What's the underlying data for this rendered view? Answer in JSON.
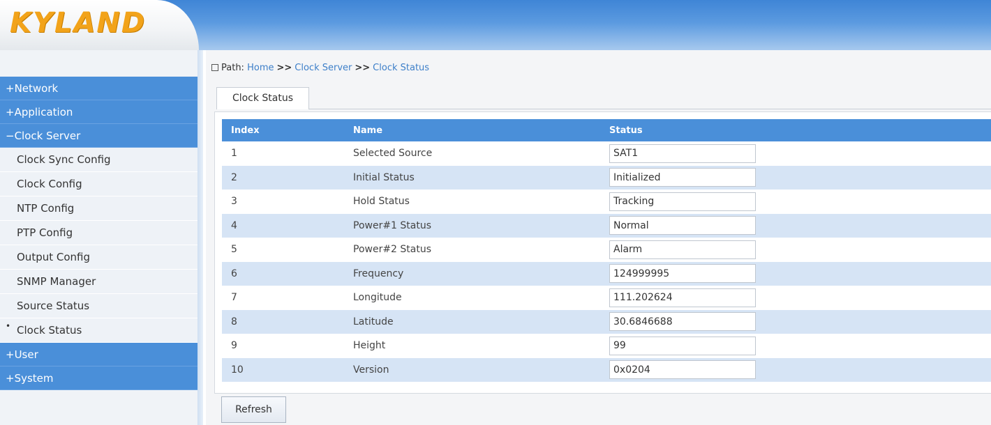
{
  "header": {
    "logo_text": "KYLAND"
  },
  "sidebar": {
    "groups_top": [
      {
        "label": "+Network"
      },
      {
        "label": "+Application"
      },
      {
        "label": "−Clock Server"
      }
    ],
    "items": [
      {
        "label": "Clock Sync Config"
      },
      {
        "label": "Clock Config"
      },
      {
        "label": "NTP Config"
      },
      {
        "label": "PTP Config"
      },
      {
        "label": "Output Config"
      },
      {
        "label": "SNMP Manager"
      },
      {
        "label": "Source Status"
      },
      {
        "label": "Clock Status",
        "active": true
      }
    ],
    "groups_bottom": [
      {
        "label": "+User"
      },
      {
        "label": "+System"
      }
    ]
  },
  "path": {
    "label": "Path:",
    "crumbs": [
      "Home",
      "Clock Server",
      "Clock Status"
    ],
    "separator": ">>"
  },
  "tab": {
    "label": "Clock Status"
  },
  "table": {
    "headers": [
      "Index",
      "Name",
      "Status"
    ],
    "rows": [
      {
        "index": "1",
        "name": "Selected Source",
        "status": "SAT1"
      },
      {
        "index": "2",
        "name": "Initial Status",
        "status": "Initialized"
      },
      {
        "index": "3",
        "name": "Hold Status",
        "status": "Tracking"
      },
      {
        "index": "4",
        "name": "Power#1 Status",
        "status": "Normal"
      },
      {
        "index": "5",
        "name": "Power#2 Status",
        "status": "Alarm"
      },
      {
        "index": "6",
        "name": "Frequency",
        "status": "124999995"
      },
      {
        "index": "7",
        "name": "Longitude",
        "status": "111.202624"
      },
      {
        "index": "8",
        "name": "Latitude",
        "status": "30.6846688"
      },
      {
        "index": "9",
        "name": "Height",
        "status": "99"
      },
      {
        "index": "10",
        "name": "Version",
        "status": "0x0204"
      }
    ]
  },
  "actions": {
    "refresh_label": "Refresh"
  },
  "colors": {
    "accent": "#4a8fd9",
    "logo": "#f2a31a",
    "row_alt": "#d6e4f5",
    "link": "#3d7fc9"
  }
}
